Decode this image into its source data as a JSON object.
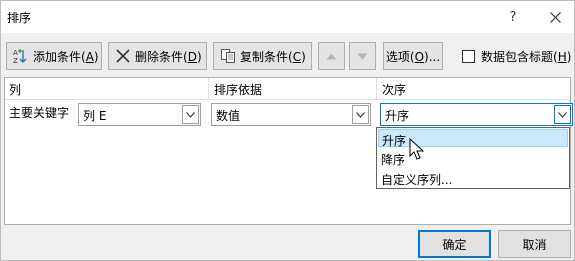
{
  "window": {
    "title": "排序",
    "help_label": "?"
  },
  "toolbar": {
    "add_label": "添加条件(",
    "add_key": "A",
    "add_tail": ")",
    "delete_label": "删除条件(",
    "delete_key": "D",
    "delete_tail": ")",
    "copy_label": "复制条件(",
    "copy_key": "C",
    "copy_tail": ")",
    "options_label": "选项(",
    "options_key": "O",
    "options_tail": ")...",
    "header_checkbox_label": "数据包含标题(",
    "header_checkbox_key": "H",
    "header_checkbox_tail": ")",
    "header_checkbox_checked": false
  },
  "grid": {
    "headers": [
      "列",
      "排序依据",
      "次序"
    ],
    "rows": [
      {
        "label": "主要关键字",
        "column": "列 E",
        "basis": "数值",
        "order": "升序"
      }
    ]
  },
  "dropdown": {
    "options": [
      "升序",
      "降序",
      "自定义序列..."
    ],
    "highlighted": "升序"
  },
  "footer": {
    "ok_label": "确定",
    "cancel_label": "取消"
  },
  "colors": {
    "accent": "#0078d7",
    "highlight": "#cce8ff"
  }
}
